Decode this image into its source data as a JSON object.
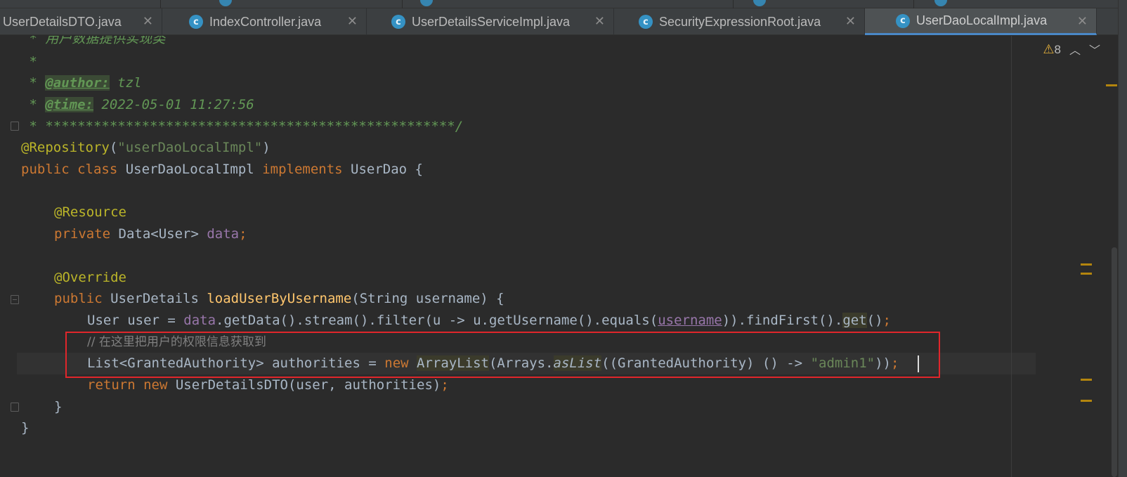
{
  "tabs": [
    {
      "label": "UserDetailsDTO.java",
      "icon": "java-class-icon",
      "active": false
    },
    {
      "label": "IndexController.java",
      "icon": "java-class-icon",
      "active": false
    },
    {
      "label": "UserDetailsServiceImpl.java",
      "icon": "java-class-icon",
      "active": false
    },
    {
      "label": "SecurityExpressionRoot.java",
      "icon": "java-class-locked-icon",
      "active": false
    },
    {
      "label": "UserDaoLocalImpl.java",
      "icon": "java-class-icon",
      "active": true
    }
  ],
  "tab_close_glyph": "✕",
  "class_icon_glyph": "c",
  "inspection": {
    "warning_count": "8"
  },
  "code": {
    "l1": " * 用户数据提供实现类",
    "l2": " *",
    "l3_prefix": " * ",
    "l3_tag": "@author:",
    "l3_val": " tzl",
    "l4_prefix": " * ",
    "l4_tag": "@time:",
    "l4_val": " 2022-05-01 11:27:56",
    "l5": " * ***************************************************/",
    "l6_ann": "@Repository",
    "l6_open": "(",
    "l6_str": "\"userDaoLocalImpl\"",
    "l6_close": ")",
    "l7_kw": "public class",
    "l7_name": " UserDaoLocalImpl ",
    "l7_kw2": "implements",
    "l7_rest": " UserDao {",
    "l9_ann": "@Resource",
    "l10_kw": "private",
    "l10_type": " Data<User> ",
    "l10_fld": "data",
    "l10_semi": ";",
    "l12_ann": "@Override",
    "l13_kw": "public",
    "l13_type": " UserDetails ",
    "l13_fn": "loadUserByUsername",
    "l13_rest": "(String username) {",
    "l14_a": "User user = ",
    "l14_fld": "data",
    "l14_b": ".getData().stream().filter(u -> u.getUsername().equals(",
    "l14_param": "username",
    "l14_c": ")).findFirst().",
    "l14_get": "get",
    "l14_d": "()",
    "l14_semi": ";",
    "l15": "// 在这里把用户的权限信息获取到",
    "l16_a": "List<GrantedAuthority> authorities = ",
    "l16_kw": "new",
    "l16_sp": " ",
    "l16_arr": "ArrayList",
    "l16_b": "(Arrays.",
    "l16_aslist": "asList",
    "l16_c": "((GrantedAuthority) () -> ",
    "l16_str": "\"admin1\"",
    "l16_d": "))",
    "l16_semi": ";",
    "l17_kw": "return new",
    "l17_rest": " UserDetailsDTO(user, authorities)",
    "l17_semi": ";",
    "l18": "}",
    "l19": "}"
  },
  "colors": {
    "keyword": "#cc7832",
    "annotation": "#bbb529",
    "string": "#6a8759",
    "method": "#ffc66d",
    "field": "#9876aa",
    "comment": "#808080",
    "doc_comment": "#629755",
    "highlight_box": "#e0262b"
  }
}
